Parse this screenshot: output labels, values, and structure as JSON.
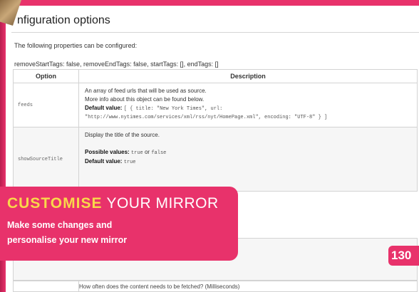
{
  "document": {
    "title": "Configuration options",
    "title_visible": "nfiguration options",
    "intro": "The following properties can be configured:",
    "settings_line": "removeStartTags: false, removeEndTags: false, startTags: [], endTags: []",
    "table": {
      "headers": [
        "Option",
        "Description"
      ],
      "rows": [
        {
          "option": "feeds",
          "lines": [
            "An array of feed urls that will be used as source.",
            "More info about this object can be found below."
          ],
          "default_label": "Default value:",
          "default_code_1": "[ { title: \"New York Times\", url:",
          "default_code_2": "\"http://www.nytimes.com/services/xml/rss/nyt/HomePage.xml\", encoding: \"UTF-8\" } ]"
        },
        {
          "option": "showSourceTitle",
          "lines": [
            "Display the title of the source."
          ],
          "possible_label": "Possible values:",
          "possible_true": "true",
          "possible_or": "or",
          "possible_false": "false",
          "default_label": "Default value:",
          "default_code": "true"
        }
      ]
    },
    "lower_row_text": "How often does the content needs to be fetched? (Milliseconds)"
  },
  "overlay": {
    "heading_highlight": "CUSTOMISE",
    "heading_rest": "YOUR MIRROR",
    "subtitle_line_1": "Make some changes and",
    "subtitle_line_2": "personalise your new mirror"
  },
  "page_number": "130",
  "colors": {
    "magazine_pink": "#e8326b",
    "highlight_yellow": "#f9d84a"
  }
}
